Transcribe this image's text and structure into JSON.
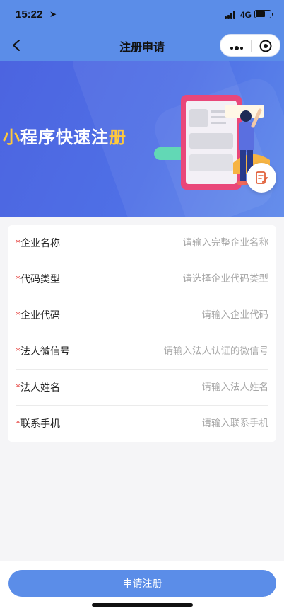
{
  "status": {
    "time": "15:22",
    "location_icon": "location-arrow-icon",
    "network": "4G",
    "battery_level": 0.65
  },
  "nav": {
    "title": "注册申请",
    "back_icon": "chevron-left-icon",
    "more_icon": "more-dots-icon",
    "close_icon": "target-close-icon"
  },
  "banner": {
    "title_prefix": "小",
    "title_main": "程序快速注",
    "title_suffix": "册",
    "edit_icon": "edit-icon"
  },
  "form": {
    "fields": [
      {
        "label": "企业名称",
        "placeholder": "请输入完整企业名称",
        "value": ""
      },
      {
        "label": "代码类型",
        "placeholder": "请选择企业代码类型",
        "value": ""
      },
      {
        "label": "企业代码",
        "placeholder": "请输入企业代码",
        "value": ""
      },
      {
        "label": "法人微信号",
        "placeholder": "请输入法人认证的微信号",
        "value": ""
      },
      {
        "label": "法人姓名",
        "placeholder": "请输入法人姓名",
        "value": ""
      },
      {
        "label": "联系手机",
        "placeholder": "请输入联系手机",
        "value": ""
      }
    ],
    "required_mark": "*"
  },
  "footer": {
    "submit_label": "申请注册"
  },
  "colors": {
    "primary": "#5b8de8",
    "banner": "#4c64e0",
    "required": "#e53935",
    "accent": "#ffc93b"
  }
}
